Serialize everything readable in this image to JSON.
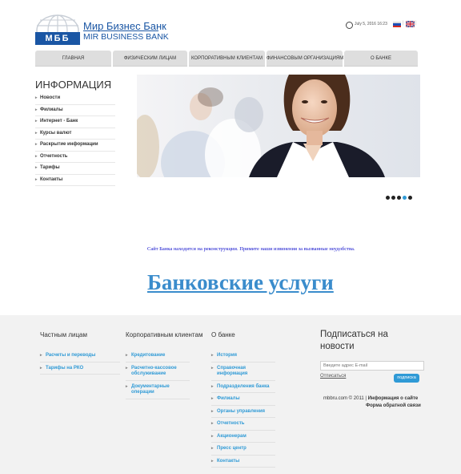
{
  "header": {
    "logo_abbr": "МББ",
    "bank_name_ru": "Мир Бизнес Банк",
    "bank_name_en": "MIR BUSINESS BANK",
    "date": "July 5, 2016 16:23"
  },
  "nav": [
    {
      "label": "ГЛАВНАЯ",
      "active": true
    },
    {
      "label": "ФИЗИЧЕСКИМ ЛИЦАМ",
      "active": false
    },
    {
      "label": "КОРПОРАТИВНЫМ КЛИЕНТАМ",
      "active": false
    },
    {
      "label": "ФИНАНСОВЫМ ОРГАНИЗАЦИЯМ",
      "active": false
    },
    {
      "label": "О БАНКЕ",
      "active": false
    }
  ],
  "sidebar": {
    "title": "ИНФОРМАЦИЯ",
    "items": [
      "Новости",
      "Филиалы",
      "Интернет - Банк",
      "Курсы валют",
      "Раскрытие информации",
      "Отчетность",
      "Тарифы",
      "Контакты"
    ]
  },
  "slider": {
    "count": 5,
    "active_index": 3
  },
  "main": {
    "notice": "Сайт Банка находится на реконструкции. Примите наши извинения за вызванные неудобства.",
    "services_link": "Банковские услуги"
  },
  "footer": {
    "col1": {
      "title": "Частным лицам",
      "items": [
        "Расчеты и переводы",
        "Тарифы на РКО"
      ]
    },
    "col2": {
      "title": "Корпоративным клиентам",
      "items": [
        "Кредитование",
        "Расчетно-кассовое обслуживание",
        "Документарные операции"
      ]
    },
    "col3": {
      "title": "О банке",
      "items": [
        "История",
        "Справочная информация",
        "Подразделения банка",
        "Филиалы",
        "Органы управления",
        "Отчетность",
        "Акционерам",
        "Пресс центр",
        "Контакты"
      ]
    },
    "subscribe": {
      "title": "Подписаться на новости",
      "placeholder": "Введите адрес E-mail",
      "unsubscribe": "Отписаться",
      "button": "подписка"
    },
    "copyright": "mbbru.com © 2011 |",
    "about_link": "Информация о сайте",
    "feedback_link": "Форма обратной связи"
  },
  "colors": {
    "accent": "#2f9ad6",
    "brand": "#1a56a4",
    "footer_bg": "#f2f2f2"
  },
  "icons": [
    "clock-icon",
    "flag-ru-icon",
    "flag-uk-icon",
    "globe-logo-icon",
    "arrow-right-icon"
  ]
}
